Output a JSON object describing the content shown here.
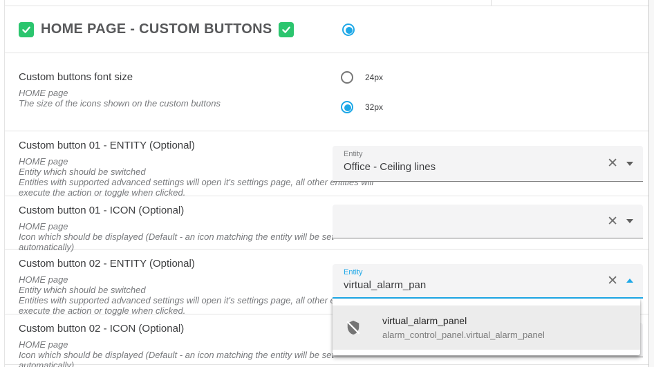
{
  "colors": {
    "accent_blue": "#1ea8e7",
    "check_green": "#2bc56e",
    "field_bg": "#f4f4f5",
    "divider": "#e3e3e3"
  },
  "icons": {
    "checked_checkbox": "check-icon",
    "clear_glyph": "✕",
    "dropdown_closed": "caret-down",
    "dropdown_open": "caret-up",
    "entity_icon": "shield-off-icon"
  },
  "header": {
    "title": "HOME PAGE - CUSTOM BUTTONS",
    "leading_checkbox_checked": true,
    "trailing_checkbox_checked": true,
    "radio_selected": true
  },
  "font_size": {
    "title": "Custom buttons font size",
    "desc_lines": [
      "HOME page",
      "The size of the icons shown on the custom buttons"
    ],
    "options": [
      {
        "label": "24px",
        "selected": false
      },
      {
        "label": "32px",
        "selected": true
      }
    ]
  },
  "b01_entity": {
    "title": "Custom button 01 - ENTITY (Optional)",
    "desc_lines": [
      "HOME page",
      "Entity which should be switched",
      "Entities with supported advanced settings will open it's settings page, all other entities will",
      "execute the action or toggle when clicked."
    ],
    "field": {
      "label": "Entity",
      "value": "Office - Ceiling lines",
      "focused": false
    }
  },
  "b01_icon": {
    "title": "Custom button 01 - ICON (Optional)",
    "desc_lines": [
      "HOME page",
      "Icon which should be displayed (Default - an icon matching the entity will be set",
      "automatically)"
    ],
    "field": {
      "label": "",
      "value": "",
      "focused": false
    }
  },
  "b02_entity": {
    "title": "Custom button 02 - ENTITY (Optional)",
    "desc_lines": [
      "HOME page",
      "Entity which should be switched",
      "Entities with supported advanced settings will open it's settings page, all other entities will",
      "execute the action or toggle when clicked."
    ],
    "field": {
      "label": "Entity",
      "value": "virtual_alarm_pan",
      "focused": true
    },
    "dropdown": {
      "open": true,
      "item": {
        "name": "virtual_alarm_panel",
        "entity_id": "alarm_control_panel.virtual_alarm_panel",
        "icon": "shield-off-icon",
        "highlighted": true
      }
    }
  },
  "b02_icon": {
    "title": "Custom button 02 - ICON (Optional)",
    "desc_lines": [
      "HOME page",
      "Icon which should be displayed (Default - an icon matching the entity will be set",
      "automatically)"
    ],
    "field": {
      "label": "",
      "value": "",
      "focused": false
    }
  }
}
